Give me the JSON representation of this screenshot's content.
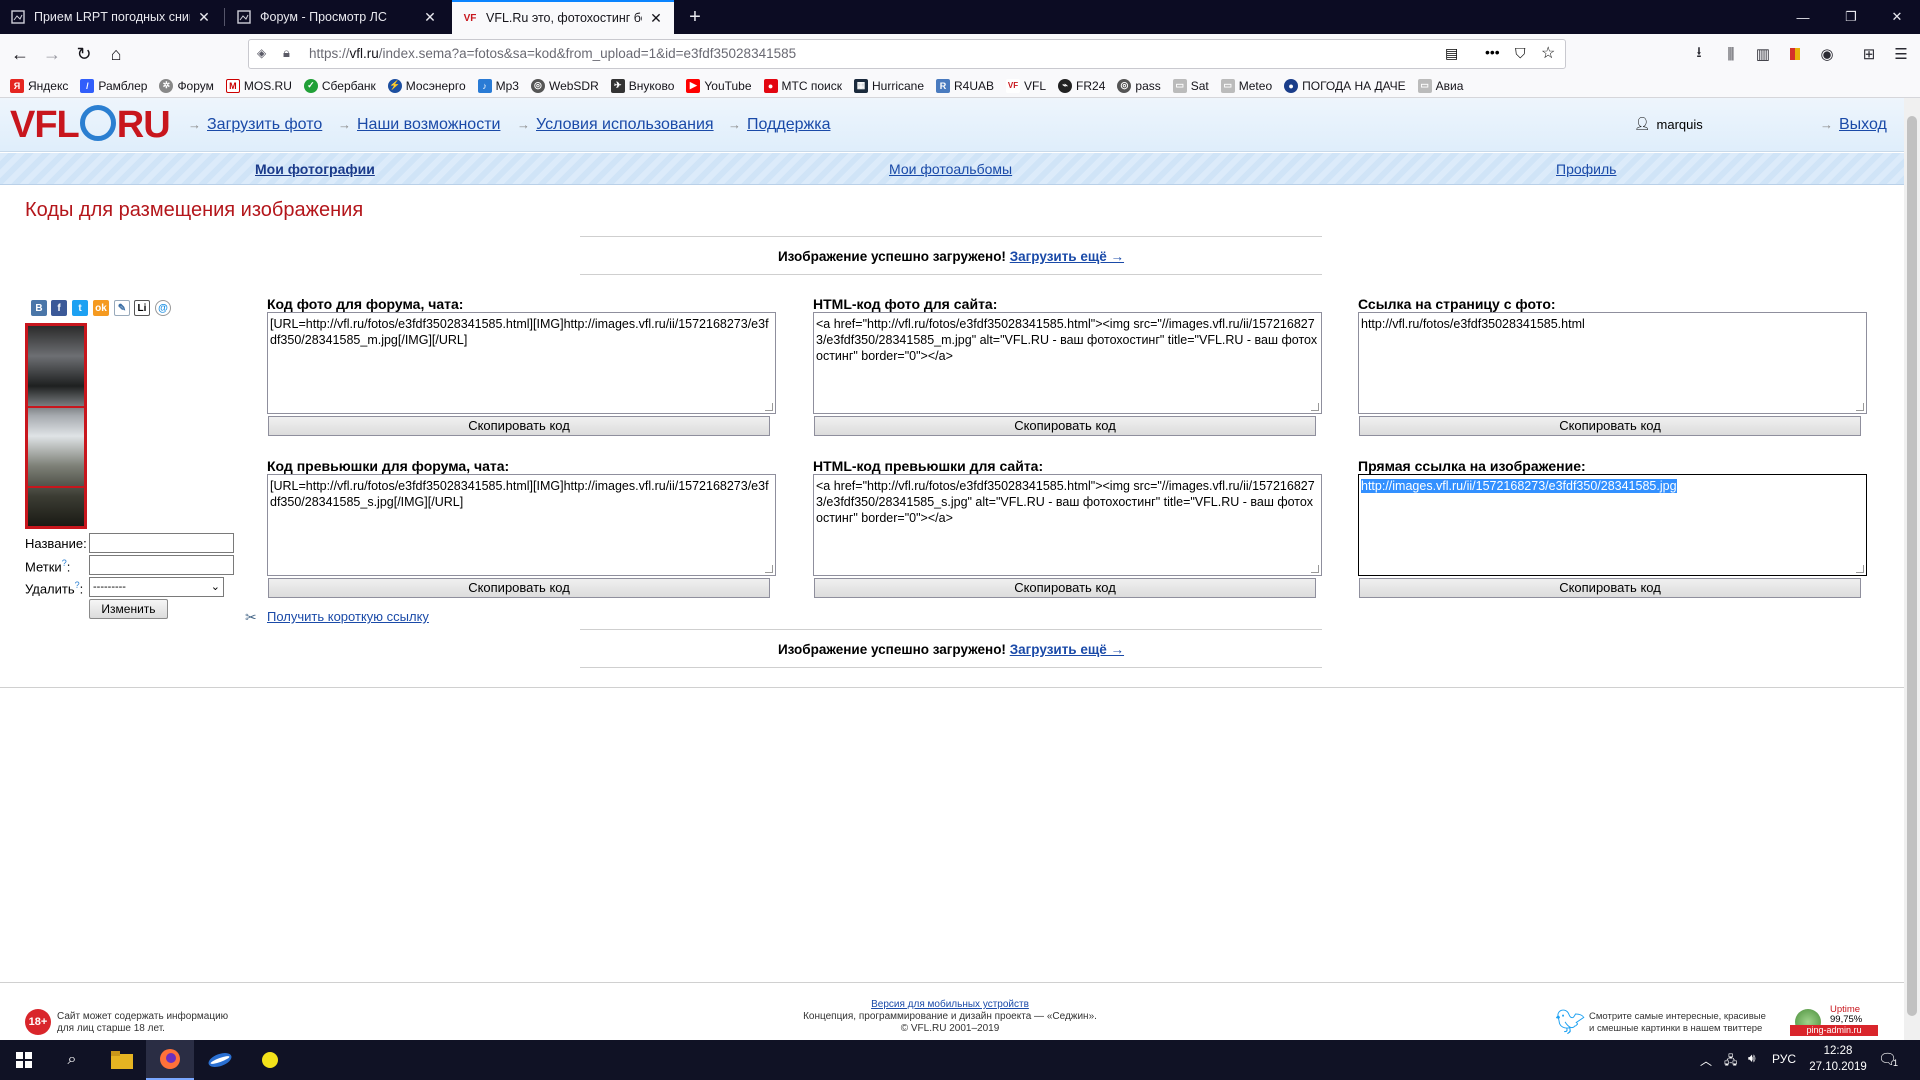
{
  "browser": {
    "tabs": [
      {
        "title": "Прием LRPT погодных снимков",
        "active": false
      },
      {
        "title": "Форум - Просмотр ЛС",
        "active": false
      },
      {
        "title": "VFL.Ru это, фотохостинг без р",
        "active": true
      }
    ],
    "url_prefix": "https://",
    "url_host": "vfl.ru",
    "url_path": "/index.sema?a=fotos&sa=kod&from_upload=1&id=e3fdf35028341585",
    "bookmarks": [
      "Яндекс",
      "Рамблер",
      "Форум",
      "MOS.RU",
      "Сбербанк",
      "Мосэнерго",
      "Mp3",
      "WebSDR",
      "Внуково",
      "YouTube",
      "МТС поиск",
      "Hurricane",
      "R4UAB",
      "VFL",
      "FR24",
      "pass",
      "Sat",
      "Meteo",
      "ПОГОДА НА ДАЧЕ",
      "Авиа"
    ]
  },
  "site": {
    "logo_left": "VFL",
    "logo_right": "RU",
    "top_links": [
      "Загрузить фото",
      "Наши возможности",
      "Условия использования",
      "Поддержка"
    ],
    "username": "marquis",
    "logout": "Выход",
    "subnav": [
      "Мои фотографии",
      "Мои фотоальбомы",
      "Профиль"
    ]
  },
  "page": {
    "title": "Коды для размещения изображения",
    "success_text": "Изображение успешно загружено!",
    "upload_more": "Загрузить ещё →",
    "form": {
      "name_label": "Название:",
      "tags_label": "Метки",
      "delete_label": "Удалить",
      "delete_value": "---------",
      "change_button": "Изменить"
    },
    "short_link": "Получить короткую ссылку",
    "copy_button": "Скопировать код",
    "codes": [
      {
        "label": "Код фото для форума, чата:",
        "value": "[URL=http://vfl.ru/fotos/e3fdf35028341585.html][IMG]http://images.vfl.ru/ii/1572168273/e3fdf350/28341585_m.jpg[/IMG][/URL]"
      },
      {
        "label": "HTML-код фото для сайта:",
        "value": "<a href=\"http://vfl.ru/fotos/e3fdf35028341585.html\"><img src=\"//images.vfl.ru/ii/1572168273/e3fdf350/28341585_m.jpg\" alt=\"VFL.RU - ваш фотохостинг\" title=\"VFL.RU - ваш фотохостинг\" border=\"0\"></a>"
      },
      {
        "label": "Ссылка на страницу с фото:",
        "value": "http://vfl.ru/fotos/e3fdf35028341585.html"
      },
      {
        "label": "Код превьюшки для форума, чата:",
        "value": "[URL=http://vfl.ru/fotos/e3fdf35028341585.html][IMG]http://images.vfl.ru/ii/1572168273/e3fdf350/28341585_s.jpg[/IMG][/URL]"
      },
      {
        "label": "HTML-код превьюшки для сайта:",
        "value": "<a href=\"http://vfl.ru/fotos/e3fdf35028341585.html\"><img src=\"//images.vfl.ru/ii/1572168273/e3fdf350/28341585_s.jpg\" alt=\"VFL.RU - ваш фотохостинг\" title=\"VFL.RU - ваш фотохостинг\" border=\"0\"></a>"
      },
      {
        "label": "Прямая ссылка на изображение:",
        "value": "http://images.vfl.ru/ii/1572168273/e3fdf350/28341585.jpg"
      }
    ]
  },
  "footer": {
    "age_badge": "18+",
    "age_text_1": "Сайт может содержать информацию",
    "age_text_2": "для лиц старше 18 лет.",
    "mobile_link": "Версия для мобильных устройств",
    "concept_text": "Концепция, программирование и дизайн проекта — «Седжин».",
    "copyright": "© VFL.RU 2001–2019",
    "twitter_text_1": "Смотрите самые интересные, красивые",
    "twitter_text_2": "и смешные картинки в нашем твиттере",
    "uptime_label": "Uptime",
    "uptime_value": "99,75%",
    "ping_label": "ping-admin.ru"
  },
  "taskbar": {
    "lang": "РУС",
    "time": "12:28",
    "date": "27.10.2019",
    "notif_count": "1"
  },
  "colors": {
    "brand_red": "#c8161d",
    "link_blue": "#1a4aa8",
    "tab_accent": "#0a84ff"
  }
}
